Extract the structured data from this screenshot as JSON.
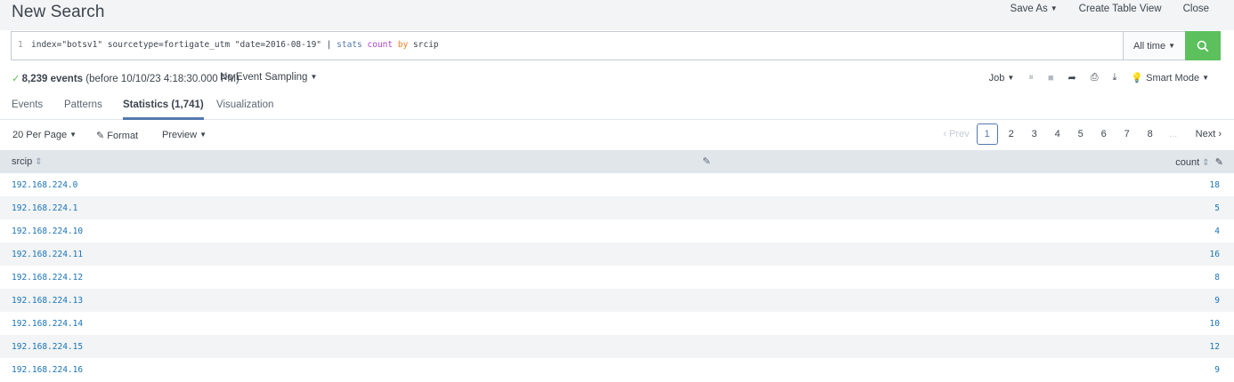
{
  "header": {
    "title": "New Search",
    "save_as": "Save As",
    "create_table_view": "Create Table View",
    "close": "Close"
  },
  "search": {
    "line_number": "1",
    "query_part1": "index=\"botsv1\" sourcetype=fortigate_utm \"date=2016-08-19\" | ",
    "query_cmd": "stats",
    "query_fn": "count",
    "query_kw": "by",
    "query_field": "srcip",
    "time_range": "All time"
  },
  "status": {
    "event_count": "8,239 events",
    "event_before": "(before 10/10/23 4:18:30.000 PM)",
    "sampling": "No Event Sampling",
    "job": "Job",
    "smart_mode": "Smart Mode"
  },
  "tabs": [
    {
      "label": "Events"
    },
    {
      "label": "Patterns"
    },
    {
      "label": "Statistics (1,741)"
    },
    {
      "label": "Visualization"
    }
  ],
  "toolbar": {
    "per_page": "20 Per Page",
    "format": "Format",
    "preview": "Preview"
  },
  "pager": {
    "prev": "‹ Prev",
    "pages": [
      "1",
      "2",
      "3",
      "4",
      "5",
      "6",
      "7",
      "8"
    ],
    "ellipsis": "...",
    "next": "Next ›"
  },
  "table": {
    "col_srcip": "srcip",
    "col_count": "count",
    "rows": [
      {
        "srcip": "192.168.224.0",
        "count": "18"
      },
      {
        "srcip": "192.168.224.1",
        "count": "5"
      },
      {
        "srcip": "192.168.224.10",
        "count": "4"
      },
      {
        "srcip": "192.168.224.11",
        "count": "16"
      },
      {
        "srcip": "192.168.224.12",
        "count": "8"
      },
      {
        "srcip": "192.168.224.13",
        "count": "9"
      },
      {
        "srcip": "192.168.224.14",
        "count": "10"
      },
      {
        "srcip": "192.168.224.15",
        "count": "12"
      },
      {
        "srcip": "192.168.224.16",
        "count": "9"
      }
    ]
  },
  "colors": {
    "link": "#1a73b9",
    "accent": "#5379af",
    "search_button": "#5cc05c"
  }
}
